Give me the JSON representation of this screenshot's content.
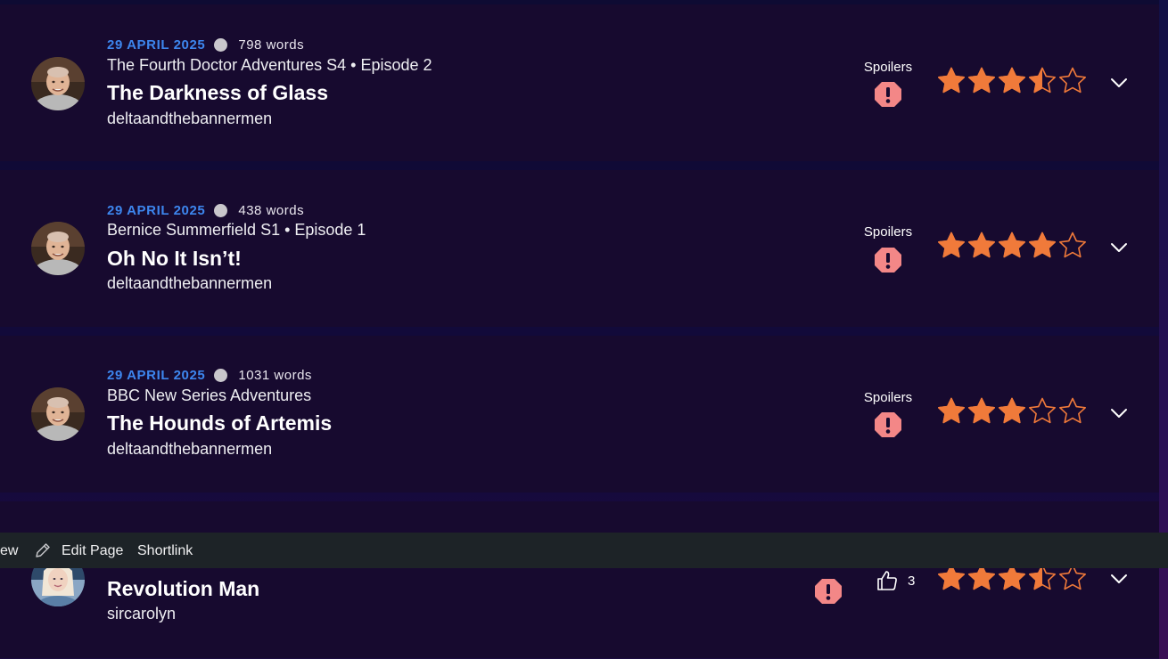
{
  "reviews": [
    {
      "date": "29 APRIL 2025",
      "words": "798  words",
      "series": "The Fourth Doctor Adventures S4 • Episode 2",
      "title": "The Darkness of Glass",
      "author": "deltaandthebannermen",
      "spoilers_label": "Spoilers",
      "rating": 3.5,
      "avatar": "reviewer-photo"
    },
    {
      "date": "29 APRIL 2025",
      "words": "438  words",
      "series": "Bernice Summerfield S1 • Episode 1",
      "title": "Oh No It Isn’t!",
      "author": "deltaandthebannermen",
      "spoilers_label": "Spoilers",
      "rating": 4,
      "avatar": "reviewer-photo"
    },
    {
      "date": "29 APRIL 2025",
      "words": "1031  words",
      "series": "BBC New Series Adventures",
      "title": "The Hounds of Artemis",
      "author": "deltaandthebannermen",
      "spoilers_label": "Spoilers",
      "rating": 3,
      "avatar": "reviewer-photo"
    },
    {
      "title": "Revolution Man",
      "author": "sircarolyn",
      "likes": "3",
      "rating": 3.5,
      "avatar": "reviewer-photo-2"
    }
  ],
  "admin_bar": {
    "view_label": "ew",
    "edit_label": "Edit Page",
    "shortlink_label": "Shortlink"
  },
  "colors": {
    "accent_date": "#3d86ee",
    "star": "#f07a3a",
    "spoiler": "#f38787",
    "card_bg": "#170a2f",
    "admin_bg": "#1d2327"
  },
  "icons": {
    "spoiler": "exclamation-octagon-icon",
    "expand": "chevron-down-icon",
    "edit": "pencil-icon",
    "like": "thumbs-up-icon",
    "star": "star-icon"
  }
}
